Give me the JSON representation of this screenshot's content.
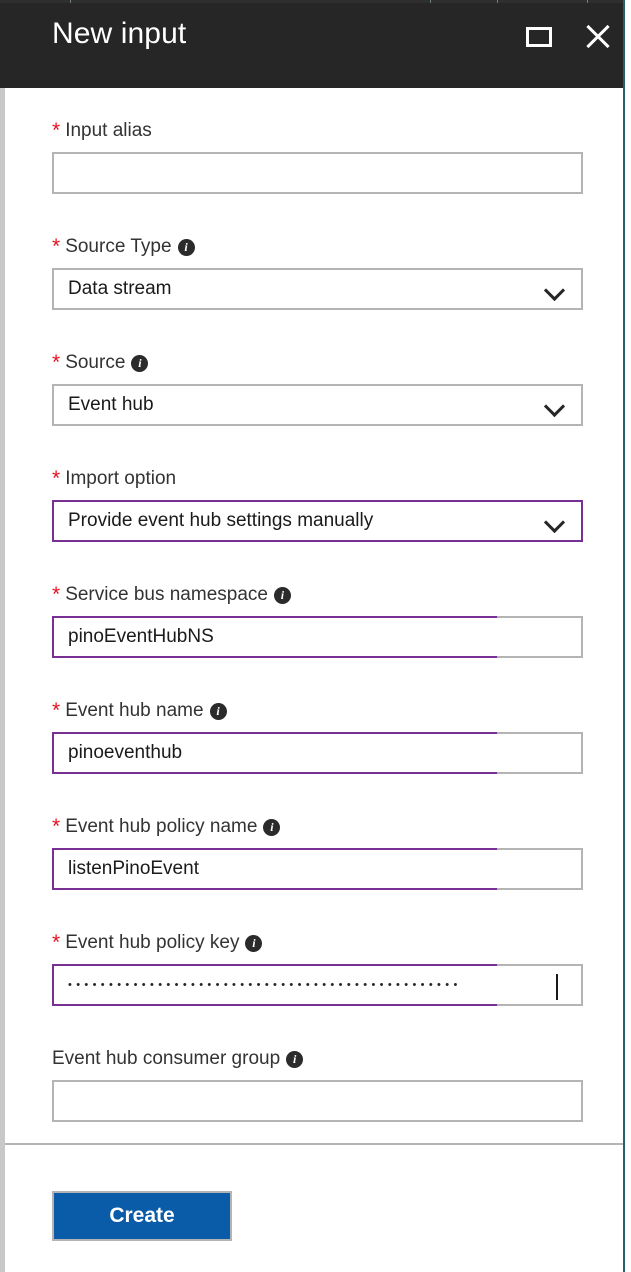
{
  "header": {
    "title": "New input",
    "maximize_icon": "maximize-icon",
    "close_icon": "close-icon"
  },
  "form": {
    "fields": [
      {
        "id": "input-alias",
        "label": "Input alias",
        "required": true,
        "info": false,
        "control": "text",
        "value": "",
        "placeholder": "",
        "state": "empty"
      },
      {
        "id": "source-type",
        "label": "Source Type",
        "required": true,
        "info": true,
        "control": "select",
        "value": "Data stream",
        "state": "default"
      },
      {
        "id": "source",
        "label": "Source",
        "required": true,
        "info": true,
        "control": "select",
        "value": "Event hub",
        "state": "default"
      },
      {
        "id": "import-option",
        "label": "Import option",
        "required": true,
        "info": false,
        "control": "select",
        "value": "Provide event hub settings manually",
        "state": "focused"
      },
      {
        "id": "service-bus-namespace",
        "label": "Service bus namespace",
        "required": true,
        "info": true,
        "control": "text",
        "value": "pinoEventHubNS",
        "placeholder": "",
        "state": "dirty"
      },
      {
        "id": "event-hub-name",
        "label": "Event hub name",
        "required": true,
        "info": true,
        "control": "text",
        "value": "pinoeventhub",
        "placeholder": "",
        "state": "dirty"
      },
      {
        "id": "event-hub-policy-name",
        "label": "Event hub policy name",
        "required": true,
        "info": true,
        "control": "text",
        "value": "listenPinoEvent",
        "placeholder": "",
        "state": "dirty"
      },
      {
        "id": "event-hub-policy-key",
        "label": "Event hub policy key",
        "required": true,
        "info": true,
        "control": "password",
        "value": "••••••••••••••••••••••••••••••••••••••••••••••••",
        "masked_char_count": 48,
        "caret": true,
        "state": "dirty"
      },
      {
        "id": "event-hub-consumer-group",
        "label": "Event hub consumer group",
        "required": false,
        "info": true,
        "control": "text",
        "value": "",
        "placeholder": "",
        "state": "empty"
      }
    ],
    "required_marker": "*",
    "info_glyph": "i"
  },
  "footer": {
    "create_label": "Create"
  },
  "colors": {
    "header_bg": "#262626",
    "accent_purple": "#7a2f94",
    "required_red": "#e81123",
    "primary_button": "#0b5ca8",
    "border_gray": "#b4b4b4",
    "blade_edge": "#2a5f72"
  }
}
